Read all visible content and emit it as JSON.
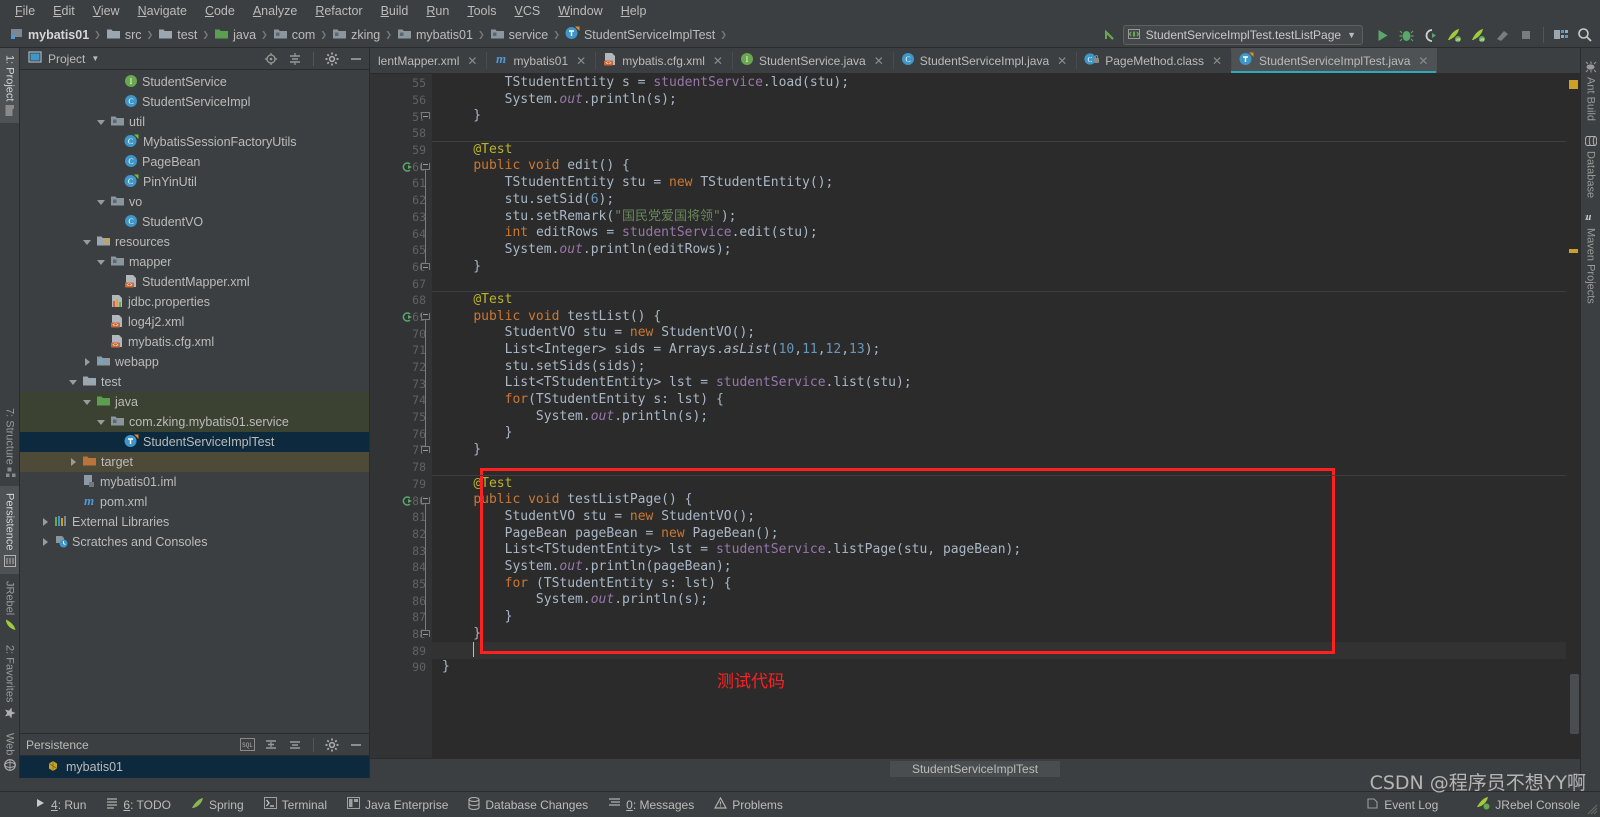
{
  "menubar": {
    "items": [
      "File",
      "Edit",
      "View",
      "Navigate",
      "Code",
      "Analyze",
      "Refactor",
      "Build",
      "Run",
      "Tools",
      "VCS",
      "Window",
      "Help"
    ]
  },
  "navbar": {
    "crumbs": [
      {
        "label": "mybatis01",
        "icon": "module-icon"
      },
      {
        "label": "src",
        "icon": "folder-icon"
      },
      {
        "label": "test",
        "icon": "folder-icon"
      },
      {
        "label": "java",
        "icon": "source-folder-icon"
      },
      {
        "label": "com",
        "icon": "package-icon"
      },
      {
        "label": "zking",
        "icon": "package-icon"
      },
      {
        "label": "mybatis01",
        "icon": "package-icon"
      },
      {
        "label": "service",
        "icon": "package-icon"
      },
      {
        "label": "StudentServiceImplTest",
        "icon": "test-class-icon"
      }
    ],
    "run_configuration": "StudentServiceImplTest.testListPage",
    "buttons": [
      "run-button",
      "debug-button",
      "run-with-coverage-button",
      "jrebel-run-button",
      "jrebel-debug-button",
      "build-button",
      "stop-button",
      "project-structure-button",
      "search-everywhere-button"
    ]
  },
  "left_strip": {
    "items": [
      "1: Project",
      "7: Structure",
      "Persistence",
      "JRebel",
      "2: Favorites",
      "Web"
    ],
    "active": "1: Project"
  },
  "right_strip": {
    "items": [
      "Ant Build",
      "Database",
      "Maven Projects"
    ]
  },
  "project_panel": {
    "title": "Project",
    "header_buttons": [
      "locate-icon",
      "collapse-all-icon",
      "settings-icon",
      "hide-icon"
    ],
    "tree": [
      {
        "label": "StudentService",
        "icon": "interface-icon",
        "indent": 6,
        "arrow": "",
        "state": ""
      },
      {
        "label": "StudentServiceImpl",
        "icon": "class-icon",
        "indent": 6,
        "arrow": "",
        "state": ""
      },
      {
        "label": "util",
        "icon": "package-icon",
        "indent": 5,
        "arrow": "down",
        "state": ""
      },
      {
        "label": "MybatisSessionFactoryUtils",
        "icon": "class-run-icon",
        "indent": 6,
        "arrow": "",
        "state": ""
      },
      {
        "label": "PageBean",
        "icon": "class-icon",
        "indent": 6,
        "arrow": "",
        "state": ""
      },
      {
        "label": "PinYinUtil",
        "icon": "class-run-icon",
        "indent": 6,
        "arrow": "",
        "state": ""
      },
      {
        "label": "vo",
        "icon": "package-icon",
        "indent": 5,
        "arrow": "down",
        "state": ""
      },
      {
        "label": "StudentVO",
        "icon": "class-icon",
        "indent": 6,
        "arrow": "",
        "state": ""
      },
      {
        "label": "resources",
        "icon": "resources-folder-icon",
        "indent": 4,
        "arrow": "down",
        "state": ""
      },
      {
        "label": "mapper",
        "icon": "package-icon",
        "indent": 5,
        "arrow": "down",
        "state": ""
      },
      {
        "label": "StudentMapper.xml",
        "icon": "xml-icon",
        "indent": 6,
        "arrow": "",
        "state": ""
      },
      {
        "label": "jdbc.properties",
        "icon": "properties-icon",
        "indent": 5,
        "arrow": "",
        "state": ""
      },
      {
        "label": "log4j2.xml",
        "icon": "xml-icon",
        "indent": 5,
        "arrow": "",
        "state": ""
      },
      {
        "label": "mybatis.cfg.xml",
        "icon": "xml-icon",
        "indent": 5,
        "arrow": "",
        "state": ""
      },
      {
        "label": "webapp",
        "icon": "web-folder-icon",
        "indent": 4,
        "arrow": "right",
        "state": ""
      },
      {
        "label": "test",
        "icon": "folder-icon",
        "indent": 3,
        "arrow": "down",
        "state": ""
      },
      {
        "label": "java",
        "icon": "source-folder-icon",
        "indent": 4,
        "arrow": "down",
        "state": "hl2"
      },
      {
        "label": "com.zking.mybatis01.service",
        "icon": "package-icon",
        "indent": 5,
        "arrow": "down",
        "state": "hl2"
      },
      {
        "label": "StudentServiceImplTest",
        "icon": "test-class-icon",
        "indent": 6,
        "arrow": "",
        "state": "sel"
      },
      {
        "label": "target",
        "icon": "target-folder-icon",
        "indent": 3,
        "arrow": "right",
        "state": "hl"
      },
      {
        "label": "mybatis01.iml",
        "icon": "iml-icon",
        "indent": 3,
        "arrow": "",
        "state": ""
      },
      {
        "label": "pom.xml",
        "icon": "maven-icon",
        "indent": 3,
        "arrow": "",
        "state": ""
      },
      {
        "label": "External Libraries",
        "icon": "libraries-icon",
        "indent": 1,
        "arrow": "right",
        "state": ""
      },
      {
        "label": "Scratches and Consoles",
        "icon": "scratches-icon",
        "indent": 1,
        "arrow": "right",
        "state": ""
      }
    ]
  },
  "persistence_panel": {
    "title": "Persistence",
    "header_buttons": [
      "sql-icon",
      "expand-all-icon",
      "collapse-all-icon",
      "settings-icon",
      "hide-icon"
    ],
    "rows": [
      {
        "label": "mybatis01",
        "icon": "persistence-unit-icon"
      }
    ]
  },
  "editor": {
    "tabs": [
      {
        "label": "lentMapper.xml",
        "icon": "xml-icon",
        "active": false,
        "truncated": true
      },
      {
        "label": "mybatis01",
        "icon": "maven-icon",
        "active": false
      },
      {
        "label": "mybatis.cfg.xml",
        "icon": "xml-icon",
        "active": false
      },
      {
        "label": "StudentService.java",
        "icon": "interface-icon",
        "active": false
      },
      {
        "label": "StudentServiceImpl.java",
        "icon": "class-icon",
        "active": false
      },
      {
        "label": "PageMethod.class",
        "icon": "class-file-icon",
        "active": false
      },
      {
        "label": "StudentServiceImplTest.java",
        "icon": "test-class-icon",
        "active": true
      }
    ],
    "first_line": 55,
    "lines": [
      {
        "n": 55,
        "indent": 8,
        "tokens": [
          [
            "typ",
            "TStudentEntity"
          ],
          [
            "plain",
            " s = "
          ],
          [
            "fldn",
            "studentService"
          ],
          [
            "plain",
            ".load(stu);"
          ]
        ]
      },
      {
        "n": 56,
        "indent": 8,
        "tokens": [
          [
            "plain",
            "System."
          ],
          [
            "fld",
            "out"
          ],
          [
            "plain",
            ".println(s);"
          ]
        ]
      },
      {
        "n": 57,
        "indent": 4,
        "tokens": [
          [
            "plain",
            "}"
          ]
        ],
        "fold": "end"
      },
      {
        "n": 58,
        "indent": 0,
        "tokens": []
      },
      {
        "n": 59,
        "indent": 4,
        "tokens": [
          [
            "anno",
            "@Test"
          ]
        ],
        "sep_above": true
      },
      {
        "n": 60,
        "indent": 4,
        "tokens": [
          [
            "kw",
            "public void "
          ],
          [
            "mth",
            "edit"
          ],
          [
            "plain",
            "() {"
          ]
        ],
        "run": true,
        "fold": "start"
      },
      {
        "n": 61,
        "indent": 8,
        "tokens": [
          [
            "typ",
            "TStudentEntity"
          ],
          [
            "plain",
            " stu = "
          ],
          [
            "kw",
            "new "
          ],
          [
            "typ",
            "TStudentEntity"
          ],
          [
            "plain",
            "();"
          ]
        ]
      },
      {
        "n": 62,
        "indent": 8,
        "tokens": [
          [
            "plain",
            "stu.setSid("
          ],
          [
            "num",
            "6"
          ],
          [
            "plain",
            ");"
          ]
        ]
      },
      {
        "n": 63,
        "indent": 8,
        "tokens": [
          [
            "plain",
            "stu.setRemark("
          ],
          [
            "str",
            "\"国民党爱国将领\""
          ],
          [
            "plain",
            ");"
          ]
        ]
      },
      {
        "n": 64,
        "indent": 8,
        "tokens": [
          [
            "kw",
            "int "
          ],
          [
            "plain",
            "editRows = "
          ],
          [
            "fldn",
            "studentService"
          ],
          [
            "plain",
            ".edit(stu);"
          ]
        ]
      },
      {
        "n": 65,
        "indent": 8,
        "tokens": [
          [
            "plain",
            "System."
          ],
          [
            "fld",
            "out"
          ],
          [
            "plain",
            ".println(editRows);"
          ]
        ]
      },
      {
        "n": 66,
        "indent": 4,
        "tokens": [
          [
            "plain",
            "}"
          ]
        ],
        "fold": "end"
      },
      {
        "n": 67,
        "indent": 0,
        "tokens": []
      },
      {
        "n": 68,
        "indent": 4,
        "tokens": [
          [
            "anno",
            "@Test"
          ]
        ],
        "sep_above": true
      },
      {
        "n": 69,
        "indent": 4,
        "tokens": [
          [
            "kw",
            "public void "
          ],
          [
            "mth",
            "testList"
          ],
          [
            "plain",
            "() {"
          ]
        ],
        "run": true,
        "fold": "start"
      },
      {
        "n": 70,
        "indent": 8,
        "tokens": [
          [
            "typ",
            "StudentVO"
          ],
          [
            "plain",
            " stu = "
          ],
          [
            "kw",
            "new "
          ],
          [
            "typ",
            "StudentVO"
          ],
          [
            "plain",
            "();"
          ]
        ]
      },
      {
        "n": 71,
        "indent": 8,
        "tokens": [
          [
            "typ",
            "List<Integer>"
          ],
          [
            "plain",
            " sids = Arrays."
          ],
          [
            "mthi",
            "asList"
          ],
          [
            "plain",
            "("
          ],
          [
            "num",
            "10"
          ],
          [
            "plain",
            ","
          ],
          [
            "num",
            "11"
          ],
          [
            "plain",
            ","
          ],
          [
            "num",
            "12"
          ],
          [
            "plain",
            ","
          ],
          [
            "num",
            "13"
          ],
          [
            "plain",
            ");"
          ]
        ]
      },
      {
        "n": 72,
        "indent": 8,
        "tokens": [
          [
            "plain",
            "stu.setSids(sids);"
          ]
        ]
      },
      {
        "n": 73,
        "indent": 8,
        "tokens": [
          [
            "typ",
            "List<TStudentEntity>"
          ],
          [
            "plain",
            " lst = "
          ],
          [
            "fldn",
            "studentService"
          ],
          [
            "plain",
            ".list(stu);"
          ]
        ]
      },
      {
        "n": 74,
        "indent": 8,
        "tokens": [
          [
            "kw",
            "for"
          ],
          [
            "plain",
            "(TStudentEntity s: lst) {"
          ]
        ]
      },
      {
        "n": 75,
        "indent": 12,
        "tokens": [
          [
            "plain",
            "System."
          ],
          [
            "fld",
            "out"
          ],
          [
            "plain",
            ".println(s);"
          ]
        ]
      },
      {
        "n": 76,
        "indent": 8,
        "tokens": [
          [
            "plain",
            "}"
          ]
        ]
      },
      {
        "n": 77,
        "indent": 4,
        "tokens": [
          [
            "plain",
            "}"
          ]
        ],
        "fold": "end"
      },
      {
        "n": 78,
        "indent": 0,
        "tokens": []
      },
      {
        "n": 79,
        "indent": 4,
        "tokens": [
          [
            "anno",
            "@Test"
          ]
        ],
        "sep_above": true
      },
      {
        "n": 80,
        "indent": 4,
        "tokens": [
          [
            "kw",
            "public void "
          ],
          [
            "mth",
            "testListPage"
          ],
          [
            "plain",
            "() {"
          ]
        ],
        "run": true,
        "fold": "start"
      },
      {
        "n": 81,
        "indent": 8,
        "tokens": [
          [
            "typ",
            "StudentVO"
          ],
          [
            "plain",
            " stu = "
          ],
          [
            "kw",
            "new "
          ],
          [
            "typ",
            "StudentVO"
          ],
          [
            "plain",
            "();"
          ]
        ]
      },
      {
        "n": 82,
        "indent": 8,
        "tokens": [
          [
            "typ",
            "PageBean"
          ],
          [
            "plain",
            " pageBean = "
          ],
          [
            "kw",
            "new "
          ],
          [
            "typ",
            "PageBean"
          ],
          [
            "plain",
            "();"
          ]
        ]
      },
      {
        "n": 83,
        "indent": 8,
        "tokens": [
          [
            "typ",
            "List<TStudentEntity>"
          ],
          [
            "plain",
            " lst = "
          ],
          [
            "fldn",
            "studentService"
          ],
          [
            "plain",
            ".listPage(stu, pageBean);"
          ]
        ]
      },
      {
        "n": 84,
        "indent": 8,
        "tokens": [
          [
            "plain",
            "System."
          ],
          [
            "fld",
            "out"
          ],
          [
            "plain",
            ".println(pageBean);"
          ]
        ]
      },
      {
        "n": 85,
        "indent": 8,
        "tokens": [
          [
            "kw",
            "for "
          ],
          [
            "plain",
            "(TStudentEntity s: lst) {"
          ]
        ]
      },
      {
        "n": 86,
        "indent": 12,
        "tokens": [
          [
            "plain",
            "System."
          ],
          [
            "fld",
            "out"
          ],
          [
            "plain",
            ".println(s);"
          ]
        ]
      },
      {
        "n": 87,
        "indent": 8,
        "tokens": [
          [
            "plain",
            "}"
          ]
        ]
      },
      {
        "n": 88,
        "indent": 4,
        "tokens": [
          [
            "plain",
            "}"
          ]
        ],
        "fold": "end"
      },
      {
        "n": 89,
        "indent": 4,
        "tokens": [],
        "caret": true
      },
      {
        "n": 90,
        "indent": 0,
        "tokens": [
          [
            "plain",
            "}"
          ]
        ]
      }
    ],
    "annotation": "测试代码",
    "status_line": "StudentServiceImplTest"
  },
  "bottombar": {
    "items": [
      {
        "label": "4: Run",
        "icon": "run-icon",
        "mnemonic": "4"
      },
      {
        "label": "6: TODO",
        "icon": "todo-icon",
        "mnemonic": "6"
      },
      {
        "label": "Spring",
        "icon": "spring-icon",
        "mnemonic": ""
      },
      {
        "label": "Terminal",
        "icon": "terminal-icon",
        "mnemonic": ""
      },
      {
        "label": "Java Enterprise",
        "icon": "java-enterprise-icon",
        "mnemonic": ""
      },
      {
        "label": "Database Changes",
        "icon": "database-changes-icon",
        "mnemonic": ""
      },
      {
        "label": "0: Messages",
        "icon": "messages-icon",
        "mnemonic": "0"
      },
      {
        "label": "Problems",
        "icon": "problems-icon",
        "mnemonic": ""
      }
    ],
    "right_items": [
      {
        "label": "Event Log",
        "icon": "event-log-icon"
      },
      {
        "label": "JRebel Console",
        "icon": "jrebel-icon"
      }
    ]
  },
  "watermark": "CSDN @程序员不想YY啊",
  "colors": {
    "background": "#3c3f41",
    "editor_background": "#2b2b2b",
    "selection": "#0d293e",
    "accent": "#2aacb8",
    "highlight_box": "#ff2020",
    "keyword": "#cc7832",
    "string": "#6a8759",
    "number": "#6897bb",
    "annotation": "#bbb529",
    "field": "#9876aa",
    "text": "#a9b7c6"
  }
}
